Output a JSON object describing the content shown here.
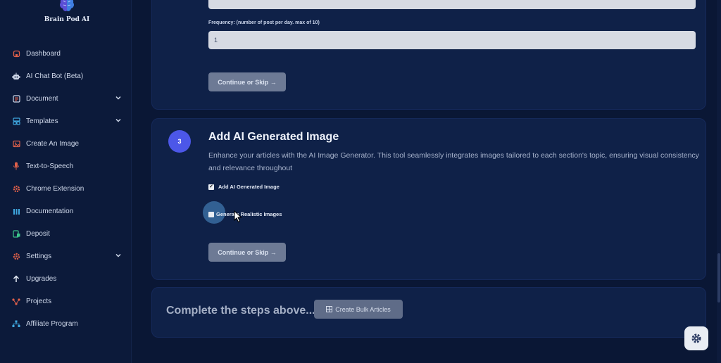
{
  "brand": {
    "name": "Brain Pod AI"
  },
  "sidebar": {
    "items": [
      {
        "label": "Dashboard",
        "icon": "home-icon",
        "color": "#e0604a",
        "chevron": false
      },
      {
        "label": "AI Chat Bot (Beta)",
        "icon": "robot-icon",
        "color": "#cfd8ea",
        "chevron": false
      },
      {
        "label": "Document",
        "icon": "document-icon",
        "color": "#e0604a",
        "chevron": true
      },
      {
        "label": "Templates",
        "icon": "templates-icon",
        "color": "#3fa8e0",
        "chevron": true
      },
      {
        "label": "Create An Image",
        "icon": "image-icon",
        "color": "#e0604a",
        "chevron": false
      },
      {
        "label": "Text-to-Speech",
        "icon": "microphone-icon",
        "color": "#e0604a",
        "chevron": false
      },
      {
        "label": "Chrome Extension",
        "icon": "gear-cog-icon",
        "color": "#e0604a",
        "chevron": false
      },
      {
        "label": "Documentation",
        "icon": "book-icon",
        "color": "#3fa8e0",
        "chevron": false
      },
      {
        "label": "Deposit",
        "icon": "deposit-icon",
        "color": "#3bc48a",
        "chevron": false
      },
      {
        "label": "Settings",
        "icon": "settings-icon",
        "color": "#e0604a",
        "chevron": true
      },
      {
        "label": "Upgrades",
        "icon": "arrow-up-icon",
        "color": "#e6ecf7",
        "chevron": false
      },
      {
        "label": "Projects",
        "icon": "projects-icon",
        "color": "#e0604a",
        "chevron": false
      },
      {
        "label": "Affiliate Program",
        "icon": "affiliate-icon",
        "color": "#3fa8e0",
        "chevron": false
      }
    ]
  },
  "step2": {
    "frequency_label": "Frequency: (number of post per day. max of 10)",
    "frequency_value": "1",
    "continue_label": "Continue or Skip →"
  },
  "step3": {
    "number": "3",
    "title": "Add AI Generated Image",
    "description": "Enhance your articles with the AI Image Generator. This tool seamlessly integrates images tailored to each section's topic, ensuring visual consistency and relevance throughout",
    "option1_label": "Add AI Generated Image",
    "option1_checked": true,
    "option2_label": "Generate Realistic Images",
    "option2_checked": false,
    "continue_label": "Continue or Skip →"
  },
  "footer": {
    "complete_text": "Complete the steps above...",
    "create_button_label": "Create Bulk Articles"
  },
  "colors": {
    "accent": "#4c57e8",
    "background": "#0a1735",
    "card": "#0f2148",
    "button": "#6d7a95"
  }
}
